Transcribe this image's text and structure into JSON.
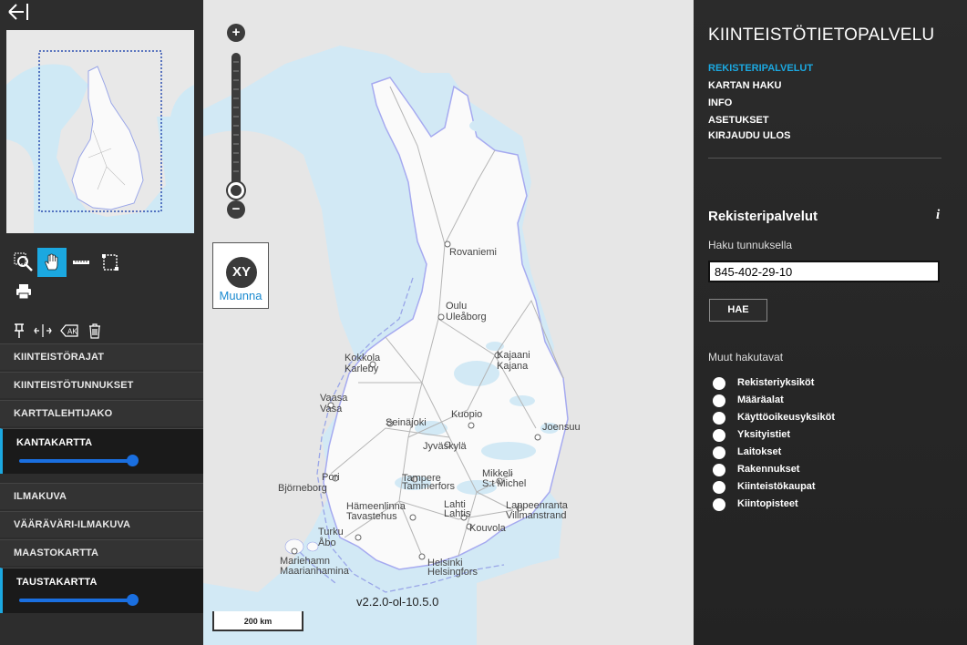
{
  "left": {
    "back_icon": "arrow-left-icon",
    "tools": [
      "zoom-box-icon",
      "pan-hand-icon",
      "measure-line-icon",
      "select-area-icon",
      "print-icon"
    ],
    "tools2": [
      "pin-icon",
      "split-measure-icon",
      "label-icon",
      "trash-icon"
    ],
    "tool2_text": "AK",
    "layers": [
      {
        "label": "KIINTEISTÖRAJAT"
      },
      {
        "label": "KIINTEISTÖTUNNUKSET"
      },
      {
        "label": "KARTTALEHTIJAKO"
      },
      {
        "label": "KANTAKARTTA",
        "active": true,
        "opacity": 1.0
      },
      {
        "label": "ILMAKUVA"
      },
      {
        "label": "VÄÄRÄVÄRI-ILMAKUVA"
      },
      {
        "label": "MAASTOKARTTA"
      },
      {
        "label": "TAUSTAKARTTA",
        "active": true,
        "opacity": 1.0
      }
    ]
  },
  "map": {
    "zoom_in": "+",
    "zoom_out": "−",
    "xy_button": "XY",
    "xy_label": "Muunna",
    "version": "v2.2.0-ol-10.5.0",
    "scale": "200 km",
    "cities": {
      "rovaniemi": "Rovaniemi",
      "oulu": "Oulu",
      "uleaborg": "Uleåborg",
      "kokkola": "Kokkola",
      "karleby": "Karleby",
      "kajaani": "Kajaani",
      "kajana": "Kajana",
      "vaasa": "Vaasa",
      "vasa": "Vasa",
      "seinajoki": "Seinäjoki",
      "kuopio": "Kuopio",
      "joensuu": "Joensuu",
      "jyvaskyla": "Jyväskylä",
      "pori": "Pori",
      "bjorneborg": "Björneborg",
      "tampere": "Tampere",
      "tammerfors": "Tammerfors",
      "mikkeli": "Mikkeli",
      "stmichel": "S:t Michel",
      "hameenlinna": "Hämeenlinna",
      "tavastehus": "Tavastehus",
      "lahti": "Lahti",
      "lahtis": "Lahtis",
      "lappeenranta": "Lappeenranta",
      "villmanstrand": "Villmanstrand",
      "kouvola": "Kouvola",
      "turku": "Turku",
      "abo": "Åbo",
      "maarianhamina": "Mariehamn",
      "maarianhamina2": "Maarianhamina",
      "helsinki": "Helsinki",
      "helsingfors": "Helsingfors"
    }
  },
  "right": {
    "title": "KIINTEISTÖTIETOPALVELU",
    "menu": [
      {
        "label": "REKISTERIPALVELUT",
        "active": true
      },
      {
        "label": "KARTAN HAKU"
      },
      {
        "label": "INFO"
      },
      {
        "label": "ASETUKSET"
      },
      {
        "label": "KIRJAUDU ULOS"
      }
    ],
    "section_title": "Rekisteripalvelut",
    "info_icon": "i",
    "search_label": "Haku tunnuksella",
    "search_value": "845-402-29-10",
    "search_button": "HAE",
    "other_label": "Muut hakutavat",
    "options": [
      "Rekisteriyksiköt",
      "Määräalat",
      "Käyttöoikeusyksiköt",
      "Yksityistiet",
      "Laitokset",
      "Rakennukset",
      "Kiinteistökaupat",
      "Kiintopisteet"
    ]
  }
}
